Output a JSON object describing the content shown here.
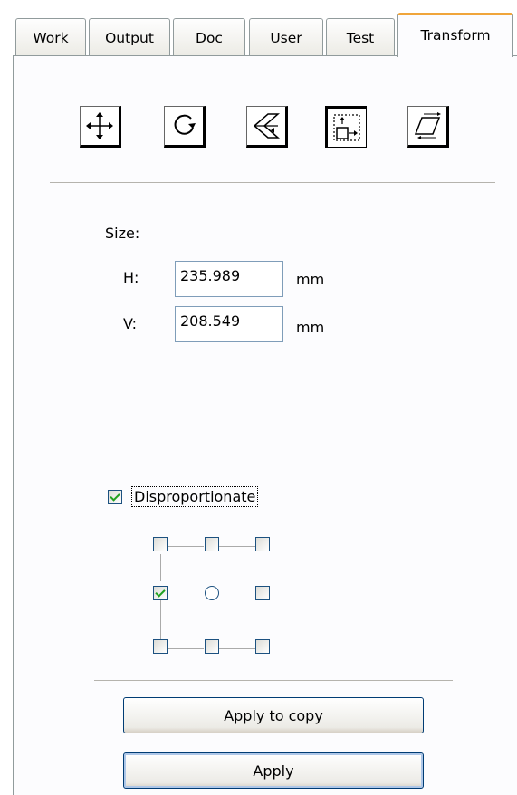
{
  "tabs": [
    {
      "label": "Work"
    },
    {
      "label": "Output"
    },
    {
      "label": "Doc"
    },
    {
      "label": "User"
    },
    {
      "label": "Test"
    },
    {
      "label": "Transform",
      "active": true
    }
  ],
  "toolbar": {
    "tools": [
      {
        "icon": "move-icon"
      },
      {
        "icon": "rotate-icon"
      },
      {
        "icon": "mirror-icon"
      },
      {
        "icon": "scale-icon",
        "active": true
      },
      {
        "icon": "skew-icon"
      }
    ]
  },
  "size": {
    "label": "Size:",
    "h_label": "H:",
    "h_value": "235.989",
    "h_unit": "mm",
    "v_label": "V:",
    "v_value": "208.549",
    "v_unit": "mm"
  },
  "disproportionate": {
    "label": "Disproportionate",
    "checked": true
  },
  "anchor_grid": {
    "selected": "middle-left"
  },
  "buttons": {
    "apply_to_copy": "Apply to copy",
    "apply": "Apply"
  },
  "colors": {
    "tab_accent": "#f0a53a",
    "check": "#21a121",
    "border": "#919b9c"
  }
}
